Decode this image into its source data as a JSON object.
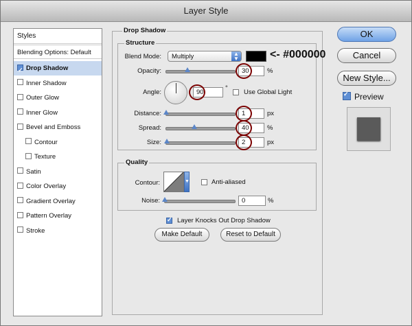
{
  "window": {
    "title": "Layer Style"
  },
  "sidebar": {
    "header": "Styles",
    "blending": "Blending Options: Default",
    "items": [
      {
        "label": "Drop Shadow",
        "checked": true,
        "selected": true,
        "indent": false
      },
      {
        "label": "Inner Shadow",
        "checked": false,
        "selected": false,
        "indent": false
      },
      {
        "label": "Outer Glow",
        "checked": false,
        "selected": false,
        "indent": false
      },
      {
        "label": "Inner Glow",
        "checked": false,
        "selected": false,
        "indent": false
      },
      {
        "label": "Bevel and Emboss",
        "checked": false,
        "selected": false,
        "indent": false
      },
      {
        "label": "Contour",
        "checked": false,
        "selected": false,
        "indent": true
      },
      {
        "label": "Texture",
        "checked": false,
        "selected": false,
        "indent": true
      },
      {
        "label": "Satin",
        "checked": false,
        "selected": false,
        "indent": false
      },
      {
        "label": "Color Overlay",
        "checked": false,
        "selected": false,
        "indent": false
      },
      {
        "label": "Gradient Overlay",
        "checked": false,
        "selected": false,
        "indent": false
      },
      {
        "label": "Pattern Overlay",
        "checked": false,
        "selected": false,
        "indent": false
      },
      {
        "label": "Stroke",
        "checked": false,
        "selected": false,
        "indent": false
      }
    ]
  },
  "drop_shadow": {
    "title": "Drop Shadow",
    "structure": {
      "title": "Structure",
      "blend_mode_label": "Blend Mode:",
      "blend_mode_value": "Multiply",
      "color_swatch": "#000000",
      "color_annotation": "<- #000000",
      "opacity_label": "Opacity:",
      "opacity_value": "30",
      "opacity_unit": "%",
      "angle_label": "Angle:",
      "angle_value": "90",
      "angle_unit": "°",
      "use_global_light": "Use Global Light",
      "distance_label": "Distance:",
      "distance_value": "1",
      "distance_unit": "px",
      "spread_label": "Spread:",
      "spread_value": "40",
      "spread_unit": "%",
      "size_label": "Size:",
      "size_value": "2",
      "size_unit": "px"
    },
    "quality": {
      "title": "Quality",
      "contour_label": "Contour:",
      "anti_aliased": "Anti-aliased",
      "noise_label": "Noise:",
      "noise_value": "0",
      "noise_unit": "%"
    },
    "knockout_label": "Layer Knocks Out Drop Shadow",
    "knockout_checked": true,
    "make_default": "Make Default",
    "reset_default": "Reset to Default"
  },
  "buttons": {
    "ok": "OK",
    "cancel": "Cancel",
    "new_style": "New Style...",
    "preview": "Preview",
    "preview_checked": true
  }
}
